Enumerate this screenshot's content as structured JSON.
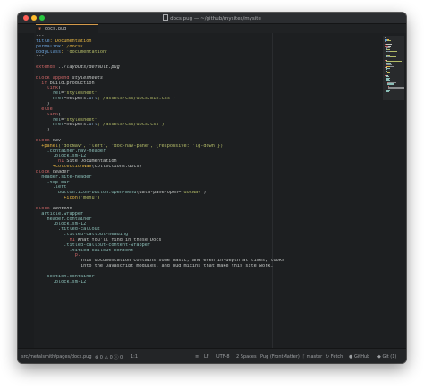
{
  "window": {
    "title": "docs.pug — ~/github/mysites/mysite"
  },
  "tab": {
    "icon": "pug-file-icon",
    "label": "docs.pug"
  },
  "editor": {
    "lines": [
      [
        [
          "---",
          "plain"
        ]
      ],
      [
        [
          "title",
          "key"
        ],
        [
          ": Documentation",
          "value"
        ]
      ],
      [
        [
          "permalink",
          "key"
        ],
        [
          ": /docs/",
          "value"
        ]
      ],
      [
        [
          "bodyClass",
          "key"
        ],
        [
          ": ",
          "value"
        ],
        [
          "'documentation'",
          "string"
        ]
      ],
      [
        [
          "---",
          "plain"
        ]
      ],
      [
        [
          "",
          ""
        ]
      ],
      [
        [
          "extends ",
          "keyword"
        ],
        [
          "../layouts/default.pug",
          "italic"
        ]
      ],
      [
        [
          "",
          ""
        ]
      ],
      [
        [
          "block append ",
          "keyword"
        ],
        [
          "stylesheets",
          "italic"
        ]
      ],
      [
        [
          "  if ",
          "keyword"
        ],
        [
          "build.production",
          "plain"
        ]
      ],
      [
        [
          "    link",
          "tag"
        ],
        [
          "(",
          "plain"
        ]
      ],
      [
        [
          "      rel",
          "attr"
        ],
        [
          "=",
          "plain"
        ],
        [
          "\"stylesheet\"",
          "string"
        ]
      ],
      [
        [
          "      href",
          "attr"
        ],
        [
          "=",
          "plain"
        ],
        [
          "helpers.",
          "plain"
        ],
        [
          "url",
          "func"
        ],
        [
          "('/assets/css/docs.min.css')",
          "string"
        ]
      ],
      [
        [
          "    )",
          "plain"
        ]
      ],
      [
        [
          "  else",
          "keyword"
        ]
      ],
      [
        [
          "    link",
          "tag"
        ],
        [
          "(",
          "plain"
        ]
      ],
      [
        [
          "      rel",
          "attr"
        ],
        [
          "=",
          "plain"
        ],
        [
          "\"stylesheet\"",
          "string"
        ]
      ],
      [
        [
          "      href",
          "attr"
        ],
        [
          "=",
          "plain"
        ],
        [
          "helpers.",
          "plain"
        ],
        [
          "url",
          "func"
        ],
        [
          "('/assets/css/docs.css')",
          "string"
        ]
      ],
      [
        [
          "    )",
          "plain"
        ]
      ],
      [
        [
          "",
          ""
        ]
      ],
      [
        [
          "block ",
          "keyword"
        ],
        [
          "nav",
          "italic"
        ]
      ],
      [
        [
          "  +panel",
          "mixin"
        ],
        [
          "('docNav', 'left', 'doc-nav-pane', {responsive: 'lg-down'})",
          "string"
        ]
      ],
      [
        [
          "    .container.nav-header",
          "class"
        ]
      ],
      [
        [
          "      .block.sm-12",
          "class"
        ]
      ],
      [
        [
          "        h1 ",
          "tag"
        ],
        [
          "Site Documentation",
          "plain"
        ]
      ],
      [
        [
          "      +collectionNav",
          "mixin"
        ],
        [
          "(collections.docs)",
          "plain"
        ]
      ],
      [
        [
          "block ",
          "keyword"
        ],
        [
          "header",
          "italic"
        ]
      ],
      [
        [
          "  header.site-header",
          "class"
        ]
      ],
      [
        [
          "    .top-bar",
          "class"
        ]
      ],
      [
        [
          "      .left",
          "class"
        ]
      ],
      [
        [
          "        button.icon-button.open-menu",
          "class"
        ],
        [
          "(data-pane-open=",
          "plain"
        ],
        [
          "'docNav'",
          "string"
        ],
        [
          ")",
          "plain"
        ]
      ],
      [
        [
          "          +icon",
          "mixin"
        ],
        [
          "('menu')",
          "string"
        ]
      ],
      [
        [
          "",
          ""
        ]
      ],
      [
        [
          "block ",
          "keyword"
        ],
        [
          "content",
          "italic"
        ]
      ],
      [
        [
          "  article.wrapper",
          "class"
        ]
      ],
      [
        [
          "    header.container",
          "class"
        ]
      ],
      [
        [
          "      .block.sm-12",
          "class"
        ]
      ],
      [
        [
          "        .titled-callout",
          "class"
        ]
      ],
      [
        [
          "          .titled-callout-heading",
          "class"
        ]
      ],
      [
        [
          "            h1 ",
          "tag"
        ],
        [
          "What You'll find in these Docs",
          "plain"
        ]
      ],
      [
        [
          "          .titled-callout-content-wrapper",
          "class"
        ]
      ],
      [
        [
          "            .titled-callout-content",
          "class"
        ]
      ],
      [
        [
          "              p.",
          "tag"
        ]
      ],
      [
        [
          "                This documentation contains some basic, and even in-depth at times, looks",
          "plain"
        ]
      ],
      [
        [
          "                into the Javascript modules, and pug mixins that make this site work.",
          "plain"
        ]
      ],
      [
        [
          "",
          ""
        ]
      ],
      [
        [
          "    section.container",
          "class"
        ]
      ],
      [
        [
          "      .block.sm-12",
          "class"
        ]
      ],
      [
        [
          "        ",
          "plain"
        ]
      ],
      [
        [
          "          ",
          "plain"
        ]
      ],
      [
        [
          "            ",
          "plain"
        ]
      ],
      [
        [
          "",
          ""
        ]
      ],
      [
        [
          "",
          ""
        ]
      ],
      [
        [
          "",
          ""
        ]
      ],
      [
        [
          "",
          ""
        ]
      ],
      [
        [
          "",
          ""
        ]
      ],
      [
        [
          "",
          ""
        ]
      ],
      [
        [
          "",
          ""
        ]
      ],
      [
        [
          "",
          ""
        ]
      ],
      [
        [
          "",
          ""
        ]
      ],
      [
        [
          "",
          ""
        ]
      ]
    ]
  },
  "statusbar": {
    "file_path": "src/metalsmith/pages/docs.pug",
    "problems": [
      {
        "icon": "error-icon",
        "count": "0"
      },
      {
        "icon": "warning-icon",
        "count": "0"
      },
      {
        "icon": "info-icon",
        "count": "0"
      }
    ],
    "cursor": "1:1",
    "line_ending": "LF",
    "encoding": "UTF-8",
    "indent": "2 Spaces",
    "grammar": "Pug (FrontMatter)",
    "branch": "master",
    "fetch": "Fetch",
    "github": "GitHub",
    "git": "Git (1)"
  },
  "colors": {
    "editor_bg": "#1d1f21",
    "keyword": "#c86464",
    "string": "#b5bd68",
    "class": "#8abeb7",
    "mixin": "#e3b341",
    "tab_accent": "#d49a4a"
  }
}
